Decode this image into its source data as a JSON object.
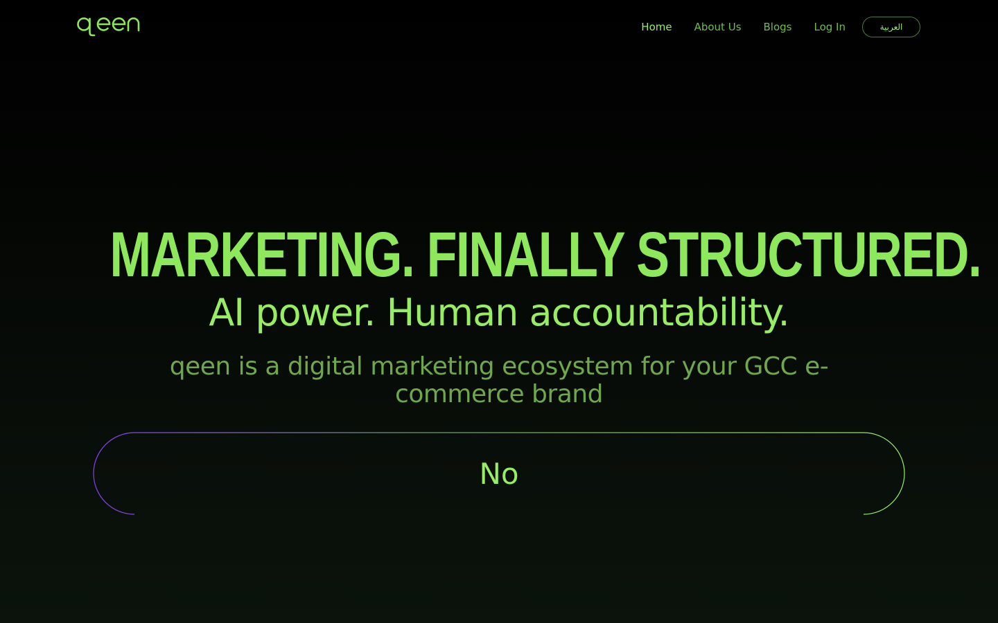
{
  "brand": {
    "logo_text": "qeen",
    "accent": "#97ee63",
    "accent_dim": "#6fbe4d"
  },
  "nav": {
    "items": [
      {
        "label": "Home",
        "active": true
      },
      {
        "label": "About Us",
        "active": false
      },
      {
        "label": "Blogs",
        "active": false
      },
      {
        "label": "Log In",
        "active": false
      }
    ],
    "language_button": "العربية"
  },
  "hero": {
    "title": "MARKETING. FINALLY STRUCTURED.",
    "subtitle": "AI power. Human accountability.",
    "description": "qeen is a digital marketing ecosystem for your GCC e-commerce brand",
    "cta_label": "No"
  }
}
